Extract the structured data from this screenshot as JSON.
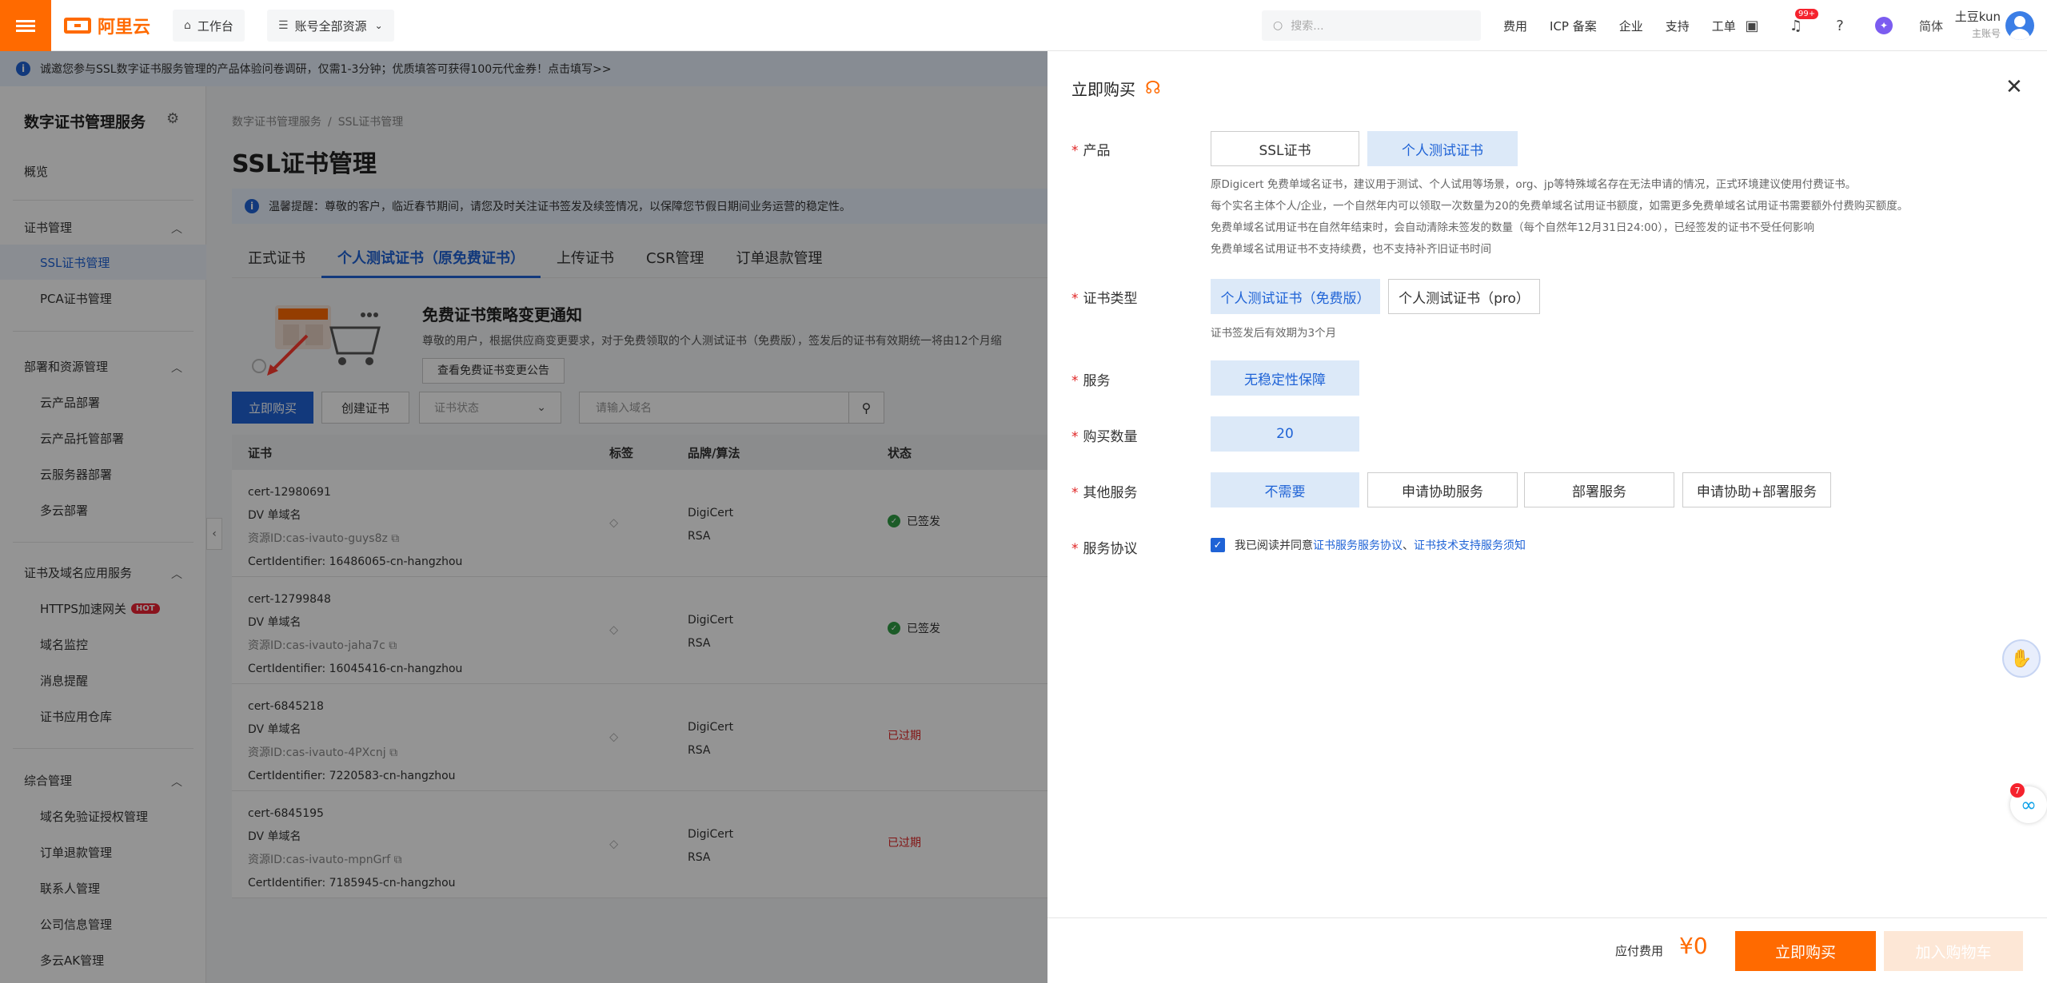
{
  "topnav": {
    "brand": "阿里云",
    "workbench": "工作台",
    "resources": "账号全部资源",
    "search_placeholder": "搜索...",
    "links": [
      "费用",
      "ICP 备案",
      "企业",
      "支持",
      "工单"
    ],
    "notify_badge": "99+",
    "lang": "简体",
    "user_name": "土豆kun",
    "user_role": "主账号"
  },
  "banner": {
    "text": "诚邀您参与SSL数字证书服务管理的产品体验问卷调研，仅需1-3分钟；优质填答可获得100元代金券！点击填写>>"
  },
  "sidebar": {
    "title": "数字证书管理服务",
    "overview": "概览",
    "group_cert": "证书管理",
    "ssl": "SSL证书管理",
    "pca": "PCA证书管理",
    "group_deploy": "部署和资源管理",
    "deploy_items": [
      "云产品部署",
      "云产品托管部署",
      "云服务器部署",
      "多云部署"
    ],
    "group_app": "证书及域名应用服务",
    "https": "HTTPS加速网关",
    "hot": "HOT",
    "app_items": [
      "域名监控",
      "消息提醒",
      "证书应用仓库"
    ],
    "group_general": "综合管理",
    "general_items": [
      "域名免验证授权管理",
      "订单退款管理",
      "联系人管理",
      "公司信息管理",
      "多云AK管理"
    ]
  },
  "main": {
    "crumb_1": "数字证书管理服务",
    "crumb_2": "SSL证书管理",
    "title": "SSL证书管理",
    "tip": "温馨提醒：尊敬的客户，临近春节期间，请您及时关注证书签发及续签情况，以保障您节假日期间业务运营的稳定性。",
    "tabs": [
      "正式证书",
      "个人测试证书（原免费证书）",
      "上传证书",
      "CSR管理",
      "订单退款管理"
    ],
    "notice_title": "免费证书策略变更通知",
    "notice_text": "尊敬的用户，根据供应商变更要求，对于免费领取的个人测试证书（免费版），签发后的证书有效期统一将由12个月缩",
    "notice_btn": "查看免费证书变更公告",
    "buy_btn": "立即购买",
    "create_btn": "创建证书",
    "status_select": "证书状态",
    "domain_placeholder": "请输入域名",
    "columns": [
      "证书",
      "标签",
      "品牌/算法",
      "状态"
    ],
    "rows": [
      {
        "id": "cert-12980691",
        "type": "DV 单域名",
        "resource": "资源ID:cas-ivauto-guys8z",
        "identifier": "CertIdentifier: 16486065-cn-hangzhou",
        "brand": "DigiCert",
        "algo": "RSA",
        "status": "已签发"
      },
      {
        "id": "cert-12799848",
        "type": "DV 单域名",
        "resource": "资源ID:cas-ivauto-jaha7c",
        "identifier": "CertIdentifier: 16045416-cn-hangzhou",
        "brand": "DigiCert",
        "algo": "RSA",
        "status": "已签发"
      },
      {
        "id": "cert-6845218",
        "type": "DV 单域名",
        "resource": "资源ID:cas-ivauto-4PXcnj",
        "identifier": "CertIdentifier: 7220583-cn-hangzhou",
        "brand": "DigiCert",
        "algo": "RSA",
        "status": "已过期"
      },
      {
        "id": "cert-6845195",
        "type": "DV 单域名",
        "resource": "资源ID:cas-ivauto-mpnGrf",
        "identifier": "CertIdentifier: 7185945-cn-hangzhou",
        "brand": "DigiCert",
        "algo": "RSA",
        "status": "已过期"
      }
    ]
  },
  "drawer": {
    "title": "立即购买",
    "product_label": "产品",
    "product_opts": [
      "SSL证书",
      "个人测试证书"
    ],
    "product_desc": [
      "原Digicert 免费单域名证书，建议用于测试、个人试用等场景，org、jp等特殊域名存在无法申请的情况，正式环境建议使用付费证书。",
      "每个实名主体个人/企业，一个自然年内可以领取一次数量为20的免费单域名试用证书额度，如需更多免费单域名试用证书需要额外付费购买额度。",
      "免费单域名试用证书在自然年结束时，会自动清除未签发的数量（每个自然年12月31日24:00），已经签发的证书不受任何影响",
      "免费单域名试用证书不支持续费，也不支持补齐旧证书时间"
    ],
    "type_label": "证书类型",
    "type_opts": [
      "个人测试证书（免费版）",
      "个人测试证书（pro）"
    ],
    "type_desc": "证书签发后有效期为3个月",
    "service_label": "服务",
    "service_opt": "无稳定性保障",
    "qty_label": "购买数量",
    "qty_value": "20",
    "other_label": "其他服务",
    "other_opts": [
      "不需要",
      "申请协助服务",
      "部署服务",
      "申请协助+部署服务"
    ],
    "agreement_label": "服务协议",
    "agree_prefix": "我已阅读并同意",
    "agree_link1": "证书服务服务协议",
    "agree_sep": "、",
    "agree_link2": "证书技术支持服务须知",
    "fee_label": "应付费用",
    "fee_value": "¥0",
    "buy_btn": "立即购买",
    "cart_btn": "加入购物车"
  },
  "chat_badge": "7"
}
